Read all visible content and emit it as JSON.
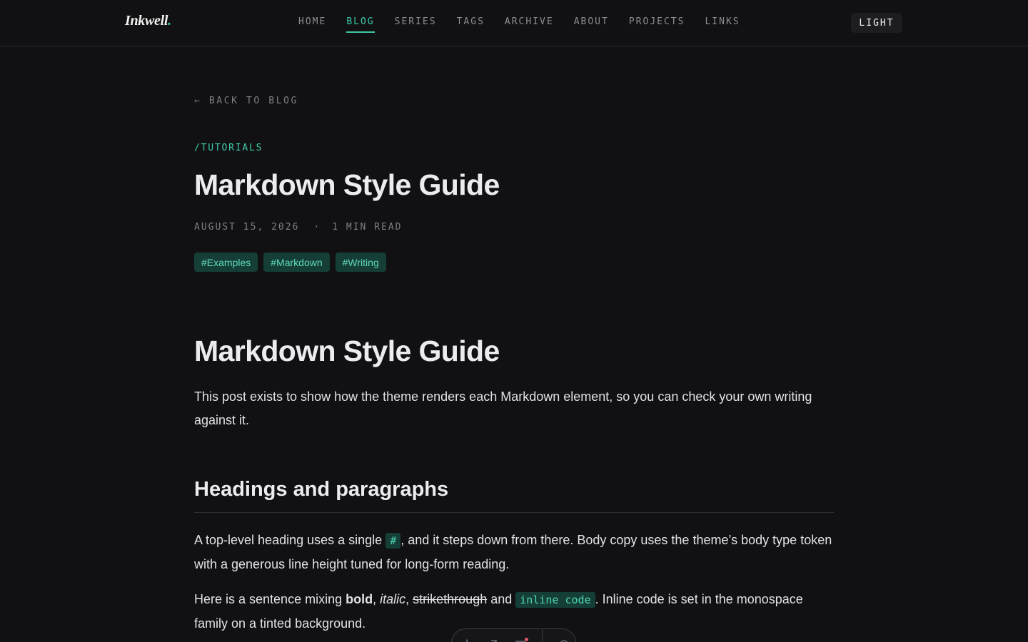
{
  "header": {
    "logo": "Inkwell",
    "logo_dot": ".",
    "nav": [
      {
        "label": "HOME",
        "active": false
      },
      {
        "label": "BLOG",
        "active": true
      },
      {
        "label": "SERIES",
        "active": false
      },
      {
        "label": "TAGS",
        "active": false
      },
      {
        "label": "ARCHIVE",
        "active": false
      },
      {
        "label": "ABOUT",
        "active": false
      },
      {
        "label": "PROJECTS",
        "active": false
      },
      {
        "label": "LINKS",
        "active": false
      }
    ],
    "theme_toggle": "LIGHT"
  },
  "post": {
    "back_link": "← BACK TO BLOG",
    "category": "/TUTORIALS",
    "title": "Markdown Style Guide",
    "date": "AUGUST 15, 2026",
    "separator": "·",
    "read_time": "1 MIN READ",
    "tags": [
      "#Examples",
      "#Markdown",
      "#Writing"
    ]
  },
  "body": {
    "h1": "Markdown Style Guide",
    "intro": "This post exists to show how the theme renders each Markdown element, so you can check your own writing against it.",
    "h2": "Headings and paragraphs",
    "p1_before": "A top-level heading uses a single ",
    "p1_code": "#",
    "p1_after": ", and it steps down from there. Body copy uses the theme’s body type token with a generous line height tuned for long-form reading.",
    "p2_start": "Here is a sentence mixing ",
    "p2_bold": "bold",
    "p2_comma1": ", ",
    "p2_italic": "italic",
    "p2_comma2": ", ",
    "p2_strike": "strikethrough",
    "p2_and": " and ",
    "p2_code": "inline code",
    "p2_end": ". Inline code is set in the monospace family on a tinted background."
  },
  "colors": {
    "accent": "#3ec9a7",
    "background": "#111113",
    "tag_background": "#153e37"
  },
  "toolbar_icons": [
    "astro-icon",
    "inspect-icon",
    "audit-icon",
    "settings-icon"
  ]
}
